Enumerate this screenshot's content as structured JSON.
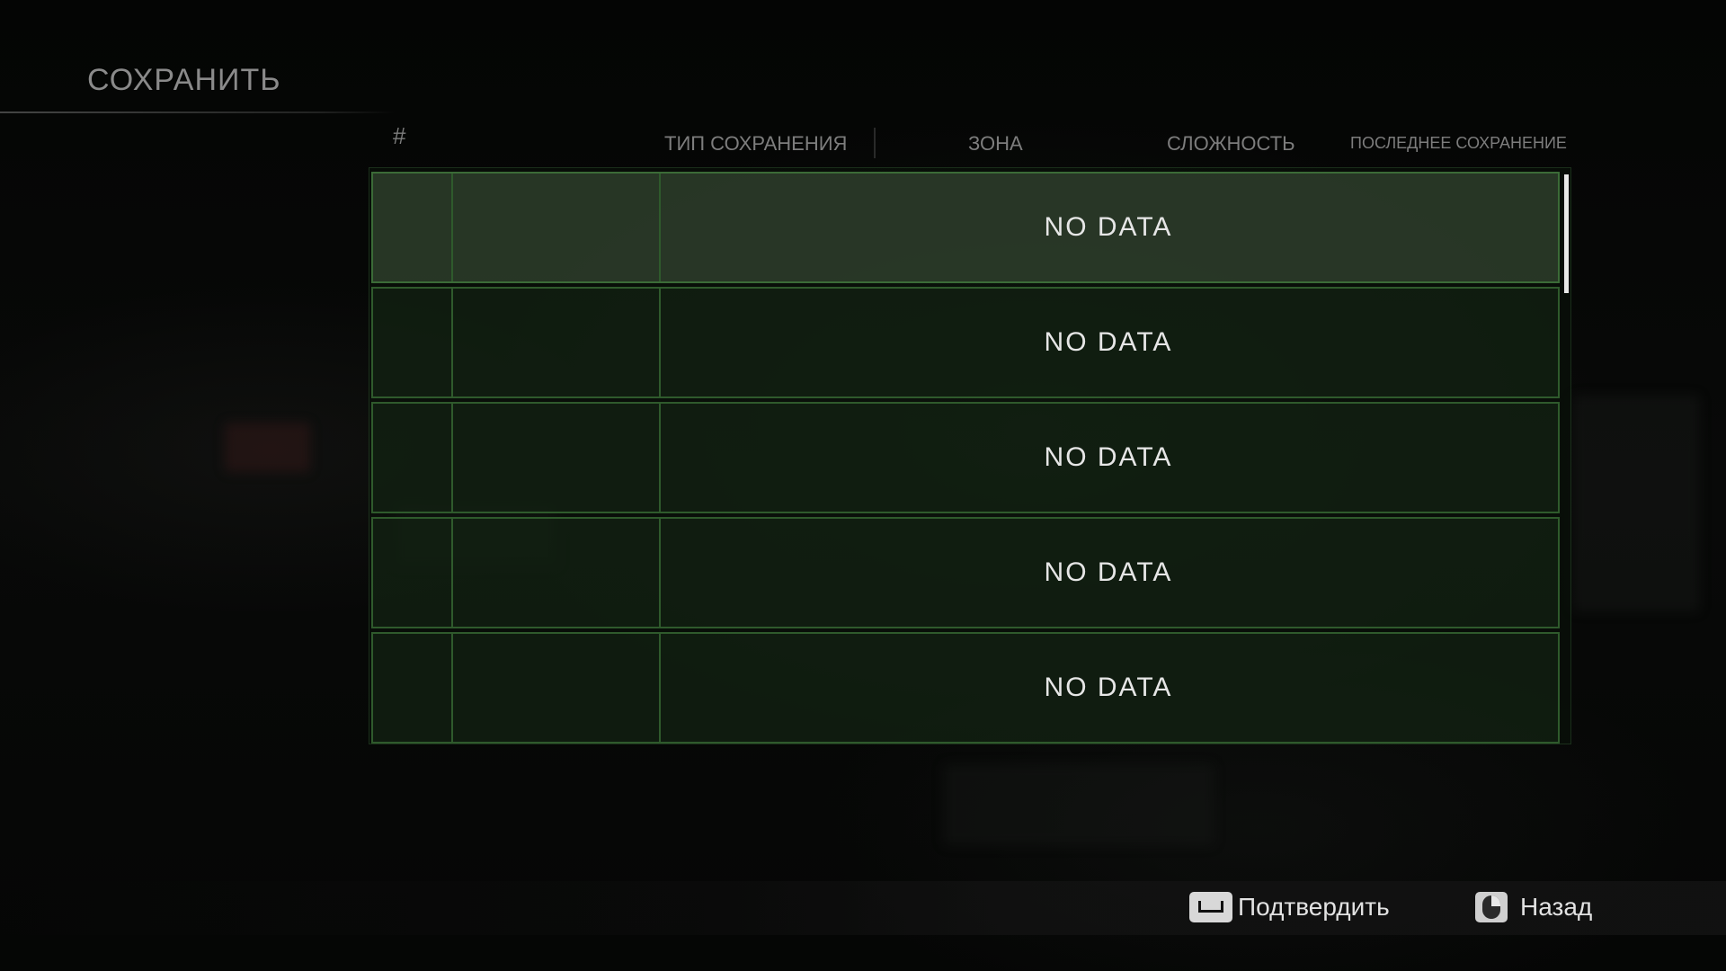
{
  "menu": {
    "title": "СОХРАНИТЬ"
  },
  "columns": {
    "number": "#",
    "save_type": "ТИП СОХРАНЕНИЯ",
    "zone": "ЗОНА",
    "difficulty": "СЛОЖНОСТЬ",
    "last_save": "ПОСЛЕДНЕЕ СОХРАНЕНИЕ"
  },
  "slots": [
    {
      "label": "NO DATA",
      "selected": true
    },
    {
      "label": "NO DATA",
      "selected": false
    },
    {
      "label": "NO DATA",
      "selected": false
    },
    {
      "label": "NO DATA",
      "selected": false
    },
    {
      "label": "NO DATA",
      "selected": false
    }
  ],
  "footer": {
    "confirm_label": "Подтвердить",
    "confirm_icon": "spacebar-key-icon",
    "back_label": "Назад",
    "back_icon": "right-mouse-button-icon"
  },
  "colors": {
    "slot_border": "#2f5a2c",
    "slot_selected": "#34463a",
    "text_primary": "#e6e6e6",
    "text_muted": "#7d7d7d"
  }
}
